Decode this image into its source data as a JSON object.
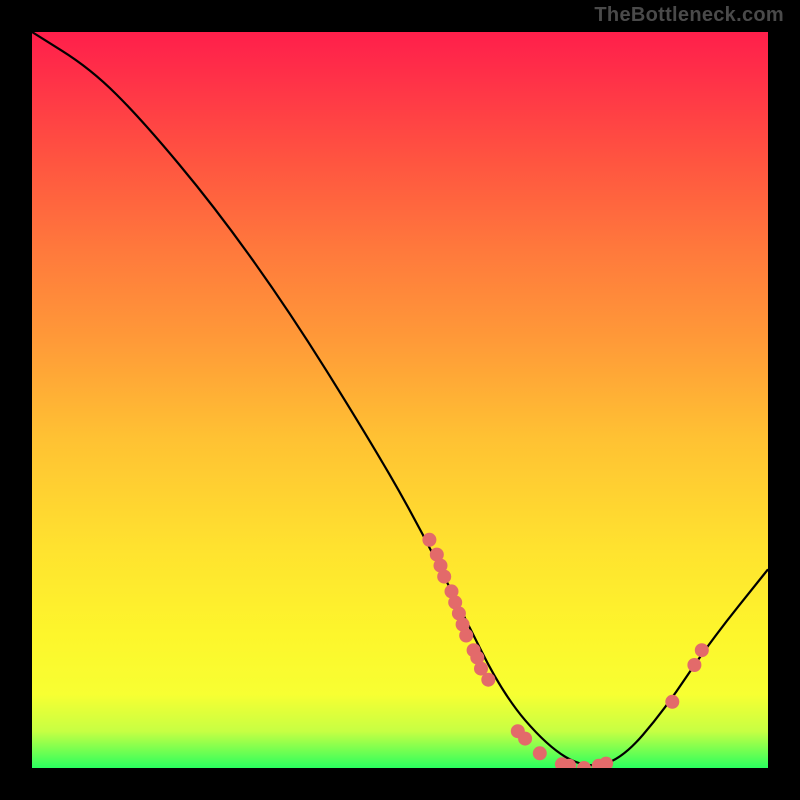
{
  "watermark": "TheBottleneck.com",
  "chart_data": {
    "type": "line",
    "title": "",
    "xlabel": "",
    "ylabel": "",
    "xlim": [
      0,
      100
    ],
    "ylim": [
      0,
      100
    ],
    "curve": [
      {
        "x": 0,
        "y": 100
      },
      {
        "x": 8,
        "y": 95
      },
      {
        "x": 15,
        "y": 88
      },
      {
        "x": 25,
        "y": 76
      },
      {
        "x": 35,
        "y": 62
      },
      {
        "x": 45,
        "y": 46
      },
      {
        "x": 52,
        "y": 34
      },
      {
        "x": 58,
        "y": 22
      },
      {
        "x": 64,
        "y": 10
      },
      {
        "x": 70,
        "y": 3
      },
      {
        "x": 75,
        "y": 0
      },
      {
        "x": 80,
        "y": 1
      },
      {
        "x": 86,
        "y": 8
      },
      {
        "x": 92,
        "y": 17
      },
      {
        "x": 100,
        "y": 27
      }
    ],
    "scatter": [
      {
        "x": 54,
        "y": 31
      },
      {
        "x": 55,
        "y": 29
      },
      {
        "x": 55.5,
        "y": 27.5
      },
      {
        "x": 56,
        "y": 26
      },
      {
        "x": 57,
        "y": 24
      },
      {
        "x": 57.5,
        "y": 22.5
      },
      {
        "x": 58,
        "y": 21
      },
      {
        "x": 58.5,
        "y": 19.5
      },
      {
        "x": 59,
        "y": 18
      },
      {
        "x": 60,
        "y": 16
      },
      {
        "x": 60.5,
        "y": 15
      },
      {
        "x": 61,
        "y": 13.5
      },
      {
        "x": 62,
        "y": 12
      },
      {
        "x": 66,
        "y": 5
      },
      {
        "x": 67,
        "y": 4
      },
      {
        "x": 69,
        "y": 2
      },
      {
        "x": 72,
        "y": 0.5
      },
      {
        "x": 73,
        "y": 0.3
      },
      {
        "x": 75,
        "y": 0
      },
      {
        "x": 77,
        "y": 0.3
      },
      {
        "x": 78,
        "y": 0.6
      },
      {
        "x": 87,
        "y": 9
      },
      {
        "x": 90,
        "y": 14
      },
      {
        "x": 91,
        "y": 16
      }
    ],
    "colors": {
      "curve": "#000000",
      "dots_fill": "#e36a6a",
      "dots_stroke": "#b04848"
    }
  }
}
